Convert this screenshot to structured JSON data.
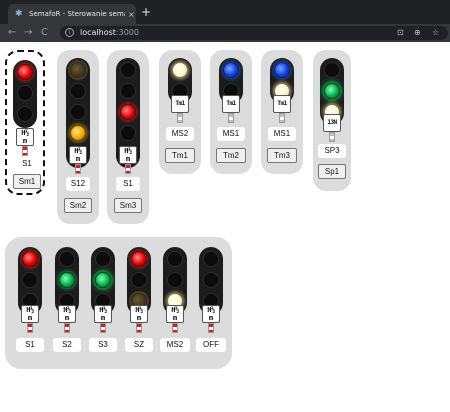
{
  "browser": {
    "tab_title": "SemafoR - Sterowanie semaforami",
    "tab_close": "×",
    "new_tab": "+",
    "nav_back": "←",
    "nav_forward": "→",
    "nav_reload": "C",
    "url_host": "localhost",
    "url_port": ":3000",
    "info_icon": "i",
    "translate_icon": "⊡",
    "zoom_icon": "⊕",
    "bookmark_icon": "☆"
  },
  "signals": [
    {
      "name": "S1",
      "plate_top": "H½",
      "plate_bottom": "m",
      "button": "Sm1"
    },
    {
      "name": "S12",
      "plate_top": "H½",
      "plate_bottom": "m",
      "button": "Sm2"
    },
    {
      "name": "S1",
      "plate_top": "H½",
      "plate_bottom": "m",
      "button": "Sm3"
    },
    {
      "name": "MS2",
      "plate_top": "Tm1",
      "button": "Tm1"
    },
    {
      "name": "MS1",
      "plate_top": "Tm1",
      "button": "Tm2"
    },
    {
      "name": "MS1",
      "plate_top": "Tm1",
      "button": "Tm3"
    },
    {
      "name": "SP3",
      "plate_top": "13N",
      "button": "Sp1"
    }
  ],
  "group": [
    {
      "name": "S1",
      "plate_top": "H½",
      "plate_bottom": "m"
    },
    {
      "name": "S2",
      "plate_top": "H½",
      "plate_bottom": "m"
    },
    {
      "name": "S3",
      "plate_top": "H½",
      "plate_bottom": "m"
    },
    {
      "name": "SZ",
      "plate_top": "H½",
      "plate_bottom": "m"
    },
    {
      "name": "MS2",
      "plate_top": "H½",
      "plate_bottom": "m"
    },
    {
      "name": "OFF",
      "plate_top": "H½",
      "plate_bottom": "m"
    }
  ],
  "colors": {
    "red": "#e00000",
    "yellow": "#f0a800",
    "green": "#00b050",
    "blue": "#1040e0",
    "white": "#fff6c8",
    "card_bg": "#dcdcdc"
  }
}
